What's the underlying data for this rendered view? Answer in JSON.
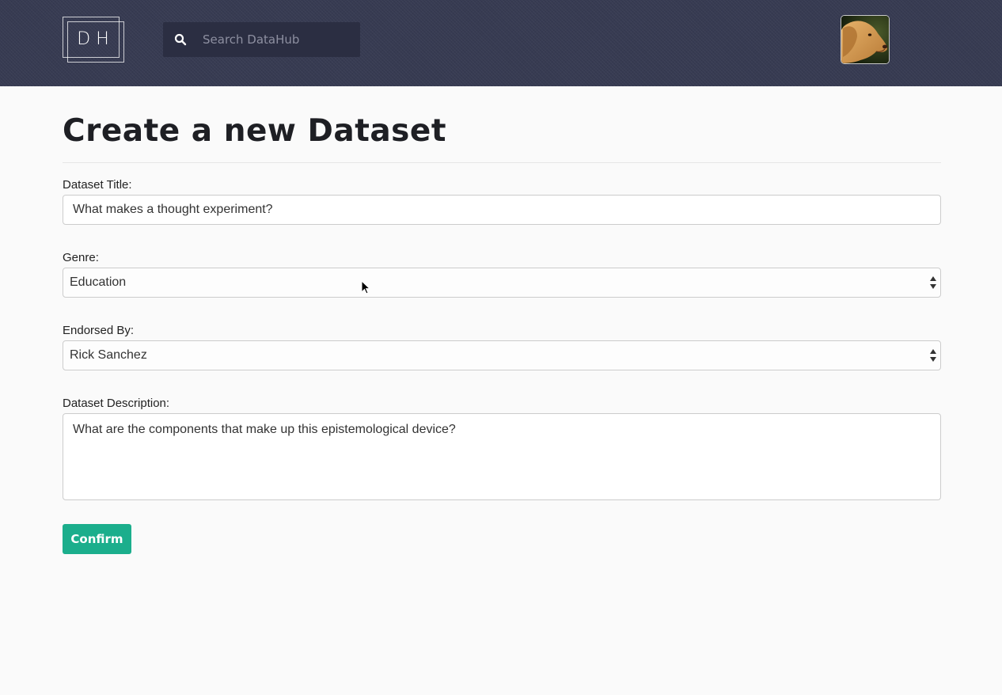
{
  "header": {
    "logo_text": "DH",
    "search_placeholder": "Search DataHub",
    "search_icon": "search-icon",
    "avatar_icon": "dog-avatar-icon"
  },
  "page": {
    "title": "Create a new Dataset"
  },
  "form": {
    "title_label": "Dataset Title:",
    "title_value": "What makes a thought experiment?",
    "genre_label": "Genre:",
    "genre_value": "Education",
    "endorsed_label": "Endorsed By:",
    "endorsed_value": "Rick Sanchez",
    "description_label": "Dataset Description:",
    "description_value": "What are the components that make up this epistemological device?",
    "confirm_label": "Confirm"
  },
  "colors": {
    "header_bg": "#373b52",
    "search_bg": "#2b2e42",
    "accent": "#1bae8c",
    "page_bg": "#fafafa"
  }
}
